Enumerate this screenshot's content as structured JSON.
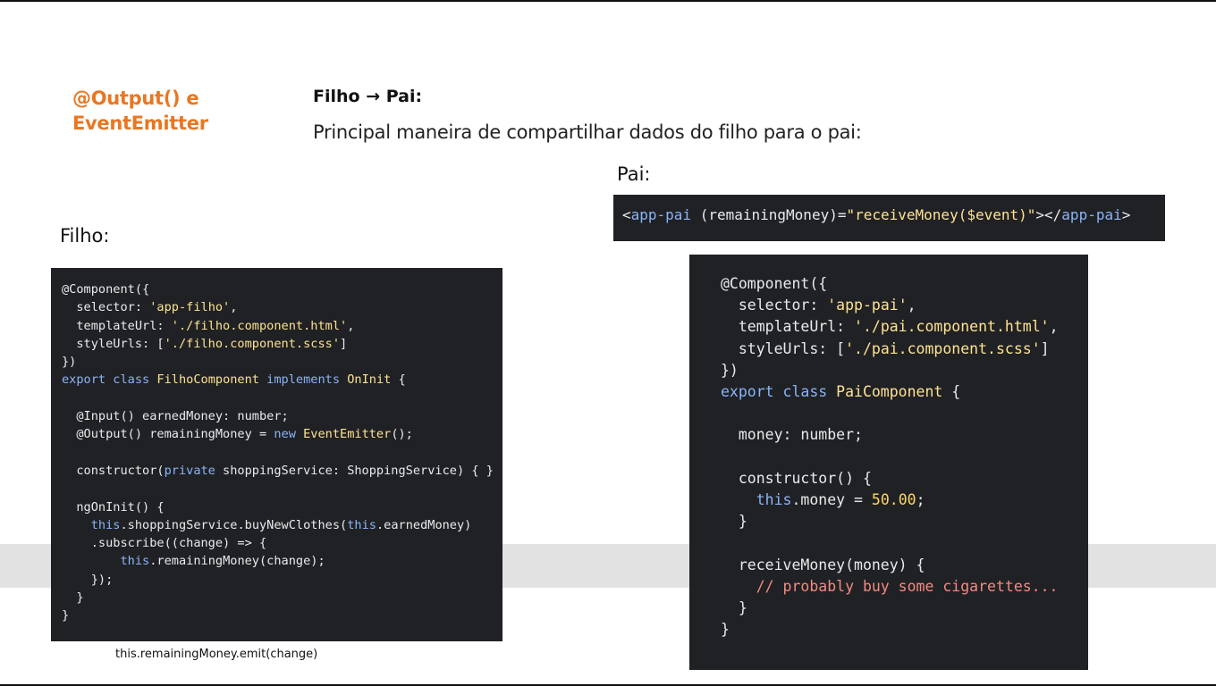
{
  "slide": {
    "title": "@Output() e\nEventEmitter",
    "heading": "Filho → Pai:",
    "subtitle": "Principal maneira de compartilhar dados do filho para o pai:"
  },
  "labels": {
    "pai": "Pai:",
    "filho": "Filho:"
  },
  "pai_template_code": [
    [
      {
        "t": "<",
        "c": "plain"
      },
      {
        "t": "app-pai",
        "c": "kw"
      },
      {
        "t": " (remainingMoney)=",
        "c": "plain"
      },
      {
        "t": "\"receiveMoney($event)\"",
        "c": "str"
      },
      {
        "t": "></",
        "c": "plain"
      },
      {
        "t": "app-pai",
        "c": "kw"
      },
      {
        "t": ">",
        "c": "plain"
      }
    ]
  ],
  "filho_code": [
    [
      {
        "t": "@Component({",
        "c": "plain"
      }
    ],
    [
      {
        "t": "  selector: ",
        "c": "plain"
      },
      {
        "t": "'app-filho'",
        "c": "str"
      },
      {
        "t": ",",
        "c": "plain"
      }
    ],
    [
      {
        "t": "  templateUrl: ",
        "c": "plain"
      },
      {
        "t": "'./filho.component.html'",
        "c": "str"
      },
      {
        "t": ",",
        "c": "plain"
      }
    ],
    [
      {
        "t": "  styleUrls: [",
        "c": "plain"
      },
      {
        "t": "'./filho.component.scss'",
        "c": "str"
      },
      {
        "t": "]",
        "c": "plain"
      }
    ],
    [
      {
        "t": "})",
        "c": "plain"
      }
    ],
    [
      {
        "t": "export class ",
        "c": "kw"
      },
      {
        "t": "FilhoComponent",
        "c": "str"
      },
      {
        "t": " implements ",
        "c": "kw"
      },
      {
        "t": "OnInit",
        "c": "str"
      },
      {
        "t": " {",
        "c": "plain"
      }
    ],
    [
      {
        "t": "",
        "c": "plain"
      }
    ],
    [
      {
        "t": "  @Input() earnedMoney: number;",
        "c": "plain"
      }
    ],
    [
      {
        "t": "  @Output() remainingMoney = ",
        "c": "plain"
      },
      {
        "t": "new ",
        "c": "kw"
      },
      {
        "t": "EventEmitter",
        "c": "str"
      },
      {
        "t": "();",
        "c": "plain"
      }
    ],
    [
      {
        "t": "",
        "c": "plain"
      }
    ],
    [
      {
        "t": "  constructor(",
        "c": "plain"
      },
      {
        "t": "private",
        "c": "kw"
      },
      {
        "t": " shoppingService: ShoppingService) { }",
        "c": "plain"
      }
    ],
    [
      {
        "t": "",
        "c": "plain"
      }
    ],
    [
      {
        "t": "  ngOnInit() {",
        "c": "plain"
      }
    ],
    [
      {
        "t": "    ",
        "c": "plain"
      },
      {
        "t": "this",
        "c": "kw"
      },
      {
        "t": ".shoppingService.buyNewClothes(",
        "c": "plain"
      },
      {
        "t": "this",
        "c": "kw"
      },
      {
        "t": ".earnedMoney)",
        "c": "plain"
      }
    ],
    [
      {
        "t": "    .subscribe((change) => {",
        "c": "plain"
      }
    ],
    [
      {
        "t": "        ",
        "c": "plain"
      },
      {
        "t": "this",
        "c": "kw"
      },
      {
        "t": ".remainingMoney(change);",
        "c": "plain"
      }
    ],
    [
      {
        "t": "    });",
        "c": "plain"
      }
    ],
    [
      {
        "t": "  }",
        "c": "plain"
      }
    ],
    [
      {
        "t": "}",
        "c": "plain"
      }
    ]
  ],
  "pai_code": [
    [
      {
        "t": "@Component({",
        "c": "plain"
      }
    ],
    [
      {
        "t": "  selector: ",
        "c": "plain"
      },
      {
        "t": "'app-pai'",
        "c": "str"
      },
      {
        "t": ",",
        "c": "plain"
      }
    ],
    [
      {
        "t": "  templateUrl: ",
        "c": "plain"
      },
      {
        "t": "'./pai.component.html'",
        "c": "str"
      },
      {
        "t": ",",
        "c": "plain"
      }
    ],
    [
      {
        "t": "  styleUrls: [",
        "c": "plain"
      },
      {
        "t": "'./pai.component.scss'",
        "c": "str"
      },
      {
        "t": "]",
        "c": "plain"
      }
    ],
    [
      {
        "t": "})",
        "c": "plain"
      }
    ],
    [
      {
        "t": "export class ",
        "c": "kw"
      },
      {
        "t": "PaiComponent",
        "c": "str"
      },
      {
        "t": " {",
        "c": "plain"
      }
    ],
    [
      {
        "t": "",
        "c": "plain"
      }
    ],
    [
      {
        "t": "  money: number;",
        "c": "plain"
      }
    ],
    [
      {
        "t": "",
        "c": "plain"
      }
    ],
    [
      {
        "t": "  constructor() {",
        "c": "plain"
      }
    ],
    [
      {
        "t": "    ",
        "c": "plain"
      },
      {
        "t": "this",
        "c": "kw"
      },
      {
        "t": ".money = ",
        "c": "plain"
      },
      {
        "t": "50.00",
        "c": "num"
      },
      {
        "t": ";",
        "c": "plain"
      }
    ],
    [
      {
        "t": "  }",
        "c": "plain"
      }
    ],
    [
      {
        "t": "",
        "c": "plain"
      }
    ],
    [
      {
        "t": "  receiveMoney(money) {",
        "c": "plain"
      }
    ],
    [
      {
        "t": "    // probably buy some cigarettes...",
        "c": "cm"
      }
    ],
    [
      {
        "t": "  }",
        "c": "plain"
      }
    ],
    [
      {
        "t": "}",
        "c": "plain"
      }
    ]
  ],
  "caption": "this.remainingMoney.emit(change)"
}
